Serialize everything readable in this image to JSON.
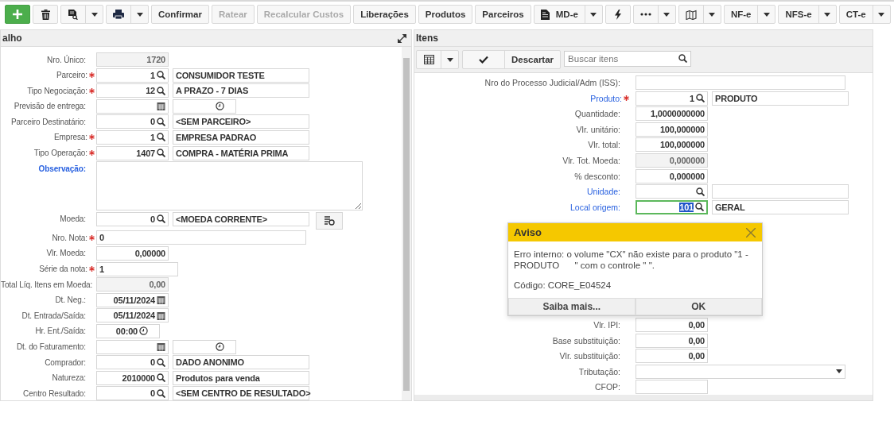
{
  "toolbar": [
    {
      "kind": "add",
      "disabled": false,
      "dropdown": false
    },
    {
      "kind": "delete",
      "disabled": false,
      "dropdown": false
    },
    {
      "kind": "report",
      "disabled": false,
      "dropdown": true
    },
    {
      "kind": "print",
      "disabled": false,
      "dropdown": true
    },
    {
      "kind": "text",
      "label": "Confirmar",
      "disabled": false,
      "dropdown": false
    },
    {
      "kind": "text",
      "label": "Ratear",
      "disabled": true,
      "dropdown": false
    },
    {
      "kind": "text",
      "label": "Recalcular Custos",
      "disabled": true,
      "dropdown": false
    },
    {
      "kind": "text",
      "label": "Liberações",
      "disabled": false,
      "dropdown": false
    },
    {
      "kind": "text",
      "label": "Produtos",
      "disabled": false,
      "dropdown": false
    },
    {
      "kind": "text",
      "label": "Parceiros",
      "disabled": false,
      "dropdown": false
    },
    {
      "kind": "document",
      "label": "MD-e",
      "disabled": false,
      "dropdown": true
    },
    {
      "kind": "action",
      "disabled": false,
      "dropdown": false
    },
    {
      "kind": "more",
      "disabled": false,
      "dropdown": true
    },
    {
      "kind": "map",
      "disabled": false,
      "dropdown": true
    },
    {
      "kind": "text",
      "label": "NF-e",
      "disabled": false,
      "dropdown": true
    },
    {
      "kind": "text",
      "label": "NFS-e",
      "disabled": false,
      "dropdown": true
    },
    {
      "kind": "text",
      "label": "CT-e",
      "disabled": false,
      "dropdown": true
    }
  ],
  "left": {
    "title": "alho",
    "rows": [
      {
        "label": "Nro. Único:",
        "required": false,
        "link": false,
        "fields": [
          {
            "kind": "readonly",
            "value": "1720"
          }
        ]
      },
      {
        "label": "Parceiro:",
        "required": true,
        "link": false,
        "fields": [
          {
            "kind": "code",
            "value": "1"
          },
          {
            "kind": "desc",
            "value": "CONSUMIDOR TESTE"
          }
        ]
      },
      {
        "label": "Tipo Negociação:",
        "required": true,
        "link": false,
        "fields": [
          {
            "kind": "code",
            "value": "12"
          },
          {
            "kind": "desc",
            "value": "A PRAZO - 7 DIAS"
          }
        ]
      },
      {
        "label": "Previsão de entrega:",
        "required": false,
        "link": false,
        "fields": [
          {
            "kind": "date"
          },
          {
            "kind": "time"
          }
        ]
      },
      {
        "label": "Parceiro Destinatário:",
        "required": false,
        "link": false,
        "fields": [
          {
            "kind": "code",
            "value": "0"
          },
          {
            "kind": "desc",
            "value": "<SEM PARCEIRO>"
          }
        ]
      },
      {
        "label": "Empresa:",
        "required": true,
        "link": false,
        "fields": [
          {
            "kind": "code",
            "value": "1"
          },
          {
            "kind": "desc",
            "value": "EMPRESA PADRAO"
          }
        ]
      },
      {
        "label": "Tipo Operação:",
        "required": true,
        "link": false,
        "fields": [
          {
            "kind": "code",
            "value": "1407"
          },
          {
            "kind": "desc",
            "value": "COMPRA - MATÉRIA PRIMA"
          }
        ]
      },
      {
        "label": "Observação:",
        "required": false,
        "link": true,
        "fields": [
          {
            "kind": "textarea"
          }
        ]
      },
      {
        "label": "Moeda:",
        "required": false,
        "link": false,
        "fields": [
          {
            "kind": "code",
            "value": "0"
          },
          {
            "kind": "desc",
            "value": "<MOEDA CORRENTE>"
          },
          {
            "kind": "icon_button"
          }
        ]
      },
      {
        "label": "Nro. Nota:",
        "required": true,
        "link": false,
        "fields": [
          {
            "kind": "text",
            "value": "0"
          }
        ]
      },
      {
        "label": "Vlr. Moeda:",
        "required": false,
        "link": false,
        "fields": [
          {
            "kind": "number",
            "value": "0,00000"
          }
        ]
      },
      {
        "label": "Série da nota:",
        "required": true,
        "link": false,
        "fields": [
          {
            "kind": "short_text",
            "value": "1"
          }
        ]
      },
      {
        "label": "Total Líq. Itens em Moeda:",
        "required": false,
        "link": false,
        "fields": [
          {
            "kind": "readonly",
            "value": "0,00"
          }
        ]
      },
      {
        "label": "Dt. Neg.:",
        "required": false,
        "link": false,
        "fields": [
          {
            "kind": "date",
            "value": "05/11/2024"
          }
        ]
      },
      {
        "label": "Dt. Entrada/Saída:",
        "required": false,
        "link": false,
        "fields": [
          {
            "kind": "date",
            "value": "05/11/2024"
          }
        ]
      },
      {
        "label": "Hr. Ent./Saída:",
        "required": false,
        "link": false,
        "fields": [
          {
            "kind": "time",
            "value": "00:00"
          }
        ]
      },
      {
        "label": "Dt. do Faturamento:",
        "required": false,
        "link": false,
        "fields": [
          {
            "kind": "date"
          },
          {
            "kind": "time"
          }
        ]
      },
      {
        "label": "Comprador:",
        "required": false,
        "link": false,
        "fields": [
          {
            "kind": "code",
            "value": "0"
          },
          {
            "kind": "desc",
            "value": "DADO ANONIMO"
          }
        ]
      },
      {
        "label": "Natureza:",
        "required": false,
        "link": false,
        "fields": [
          {
            "kind": "code",
            "value": "2010000"
          },
          {
            "kind": "desc",
            "value": "Produtos para venda"
          }
        ]
      },
      {
        "label": "Centro Resultado:",
        "required": false,
        "link": false,
        "fields": [
          {
            "kind": "code",
            "value": "0"
          },
          {
            "kind": "desc",
            "value": "<SEM CENTRO DE RESULTADO>"
          }
        ]
      }
    ]
  },
  "right": {
    "title": "Itens",
    "toolbar": {
      "action": "Descartar",
      "search": {
        "placeholder": "Buscar itens"
      }
    },
    "rows": [
      {
        "label": "Nro do Processo Judicial/Adm (ISS):",
        "required": false,
        "link": false,
        "fields": [
          {
            "kind": "wide"
          }
        ]
      },
      {
        "label": "Produto:",
        "required": true,
        "link": true,
        "fields": [
          {
            "kind": "code",
            "value": "1"
          },
          {
            "kind": "desc",
            "value": "PRODUTO"
          }
        ]
      },
      {
        "label": "Quantidade:",
        "required": false,
        "link": false,
        "fields": [
          {
            "kind": "number",
            "value": "1,0000000000"
          }
        ]
      },
      {
        "label": "Vlr. unitário:",
        "required": false,
        "link": false,
        "fields": [
          {
            "kind": "number",
            "value": "100,000000"
          }
        ]
      },
      {
        "label": "Vlr. total:",
        "required": false,
        "link": false,
        "fields": [
          {
            "kind": "number",
            "value": "100,000000"
          }
        ]
      },
      {
        "label": "Vlr. Tot. Moeda:",
        "required": false,
        "link": false,
        "fields": [
          {
            "kind": "readonly",
            "value": "0,000000"
          }
        ]
      },
      {
        "label": "% desconto:",
        "required": false,
        "link": false,
        "fields": [
          {
            "kind": "number",
            "value": "0,000000"
          }
        ]
      },
      {
        "label": "Unidade:",
        "required": false,
        "link": true,
        "fields": [
          {
            "kind": "code"
          },
          {
            "kind": "desc"
          }
        ]
      },
      {
        "label": "Local origem:",
        "required": false,
        "link": true,
        "fields": [
          {
            "kind": "code",
            "value": "101",
            "focused": true
          },
          {
            "kind": "desc",
            "value": "GERAL"
          }
        ]
      },
      {
        "kind": "hidden"
      },
      {
        "label": "Vlr. IPI:",
        "required": false,
        "link": false,
        "fields": [
          {
            "kind": "number",
            "value": "0,00"
          }
        ]
      },
      {
        "label": "Base substituição:",
        "required": false,
        "link": false,
        "fields": [
          {
            "kind": "number",
            "value": "0,00"
          }
        ]
      },
      {
        "label": "Vlr. substituição:",
        "required": false,
        "link": false,
        "fields": [
          {
            "kind": "number",
            "value": "0,00"
          }
        ]
      },
      {
        "label": "Tributação:",
        "required": false,
        "link": false,
        "fields": [
          {
            "kind": "select"
          }
        ]
      },
      {
        "label": "CFOP:",
        "required": false,
        "link": false,
        "fields": [
          {
            "kind": "number"
          }
        ]
      }
    ]
  },
  "dialog": {
    "title": "Aviso",
    "message": "Erro interno: o volume \"CX\" não existe para o produto \"1 - PRODUTO      \" com o controle \" \".",
    "code": "Código: CORE_E04524",
    "buttons": [
      "Saiba mais...",
      "OK"
    ]
  }
}
